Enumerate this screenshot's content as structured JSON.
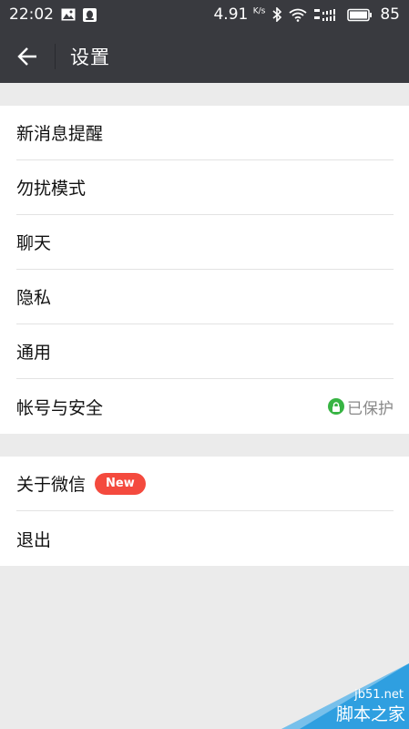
{
  "status_bar": {
    "time": "22:02",
    "network_speed": "4.91",
    "speed_unit": "K/s",
    "battery_level": "85"
  },
  "header": {
    "title": "设置"
  },
  "settings": {
    "group1": [
      {
        "label": "新消息提醒"
      },
      {
        "label": "勿扰模式"
      },
      {
        "label": "聊天"
      },
      {
        "label": "隐私"
      },
      {
        "label": "通用"
      },
      {
        "label": "帐号与安全",
        "status": "已保护"
      }
    ],
    "group2": [
      {
        "label": "关于微信",
        "badge": "New"
      },
      {
        "label": "退出"
      }
    ]
  },
  "watermark": {
    "line1": "jb51.net",
    "line2": "脚本之家"
  },
  "colors": {
    "header_bg": "#393a3f",
    "page_bg": "#ebebeb",
    "badge_red": "#f44a3e",
    "lock_green": "#37b443",
    "watermark_blue": "#2f9fe0"
  }
}
